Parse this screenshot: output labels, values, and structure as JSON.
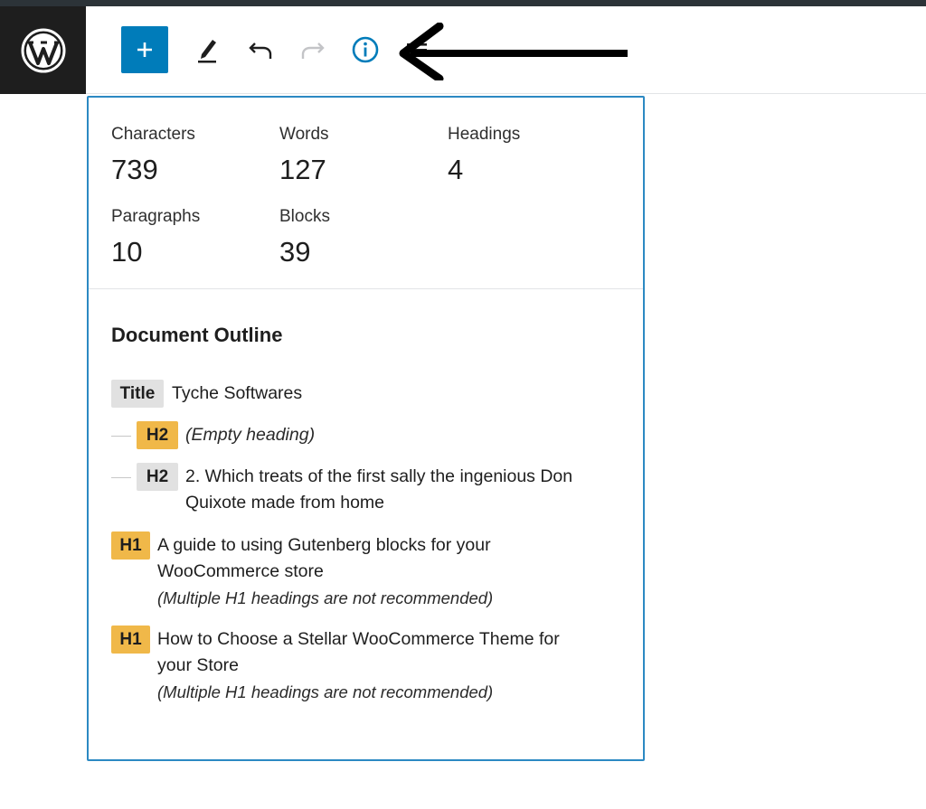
{
  "toolbar": {
    "add_icon": "plus-icon",
    "tools_icon": "pencil-icon",
    "undo_icon": "undo-icon",
    "redo_icon": "redo-icon",
    "info_icon": "info-icon",
    "logo_icon": "wordpress-logo",
    "accent_color": "#007cba"
  },
  "stats": {
    "characters_label": "Characters",
    "characters_value": "739",
    "words_label": "Words",
    "words_value": "127",
    "headings_label": "Headings",
    "headings_value": "4",
    "paragraphs_label": "Paragraphs",
    "paragraphs_value": "10",
    "blocks_label": "Blocks",
    "blocks_value": "39"
  },
  "outline": {
    "title": "Document Outline",
    "items": [
      {
        "badge": "Title",
        "text": "Tyche Softwares"
      },
      {
        "badge": "H2",
        "text": "(Empty heading)"
      },
      {
        "badge": "H2",
        "text_line1": "2. Which treats of the first sally the ingenious Don",
        "text_line2": "Quixote made from home"
      },
      {
        "badge": "H1",
        "text_line1": "A guide to using Gutenberg blocks for your",
        "text_line2": "WooCommerce store",
        "warning": "(Multiple H1 headings are not recommended)"
      },
      {
        "badge": "H1",
        "text_line1": "How to Choose a Stellar WooCommerce Theme for",
        "text_line2": "your Store",
        "warning": "(Multiple H1 headings are not recommended)"
      }
    ]
  },
  "colors": {
    "panel_border": "#2c89c3",
    "badge_warning": "#f0b849",
    "badge_default": "#e1e1e1"
  }
}
